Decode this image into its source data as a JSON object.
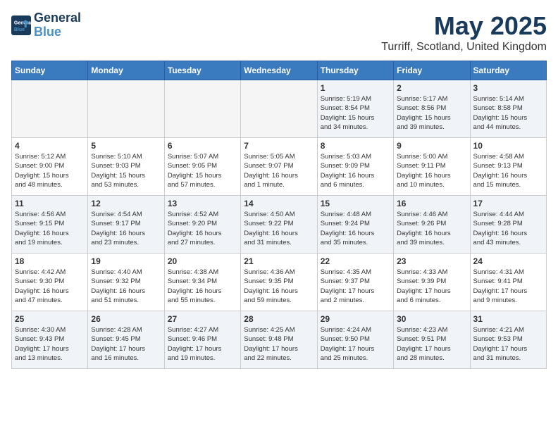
{
  "logo": {
    "line1": "General",
    "line2": "Blue"
  },
  "title": "May 2025",
  "location": "Turriff, Scotland, United Kingdom",
  "days_of_week": [
    "Sunday",
    "Monday",
    "Tuesday",
    "Wednesday",
    "Thursday",
    "Friday",
    "Saturday"
  ],
  "weeks": [
    [
      {
        "day": "",
        "info": "",
        "empty": true
      },
      {
        "day": "",
        "info": "",
        "empty": true
      },
      {
        "day": "",
        "info": "",
        "empty": true
      },
      {
        "day": "",
        "info": "",
        "empty": true
      },
      {
        "day": "1",
        "info": "Sunrise: 5:19 AM\nSunset: 8:54 PM\nDaylight: 15 hours\nand 34 minutes."
      },
      {
        "day": "2",
        "info": "Sunrise: 5:17 AM\nSunset: 8:56 PM\nDaylight: 15 hours\nand 39 minutes."
      },
      {
        "day": "3",
        "info": "Sunrise: 5:14 AM\nSunset: 8:58 PM\nDaylight: 15 hours\nand 44 minutes."
      }
    ],
    [
      {
        "day": "4",
        "info": "Sunrise: 5:12 AM\nSunset: 9:00 PM\nDaylight: 15 hours\nand 48 minutes."
      },
      {
        "day": "5",
        "info": "Sunrise: 5:10 AM\nSunset: 9:03 PM\nDaylight: 15 hours\nand 53 minutes."
      },
      {
        "day": "6",
        "info": "Sunrise: 5:07 AM\nSunset: 9:05 PM\nDaylight: 15 hours\nand 57 minutes."
      },
      {
        "day": "7",
        "info": "Sunrise: 5:05 AM\nSunset: 9:07 PM\nDaylight: 16 hours\nand 1 minute."
      },
      {
        "day": "8",
        "info": "Sunrise: 5:03 AM\nSunset: 9:09 PM\nDaylight: 16 hours\nand 6 minutes."
      },
      {
        "day": "9",
        "info": "Sunrise: 5:00 AM\nSunset: 9:11 PM\nDaylight: 16 hours\nand 10 minutes."
      },
      {
        "day": "10",
        "info": "Sunrise: 4:58 AM\nSunset: 9:13 PM\nDaylight: 16 hours\nand 15 minutes."
      }
    ],
    [
      {
        "day": "11",
        "info": "Sunrise: 4:56 AM\nSunset: 9:15 PM\nDaylight: 16 hours\nand 19 minutes."
      },
      {
        "day": "12",
        "info": "Sunrise: 4:54 AM\nSunset: 9:17 PM\nDaylight: 16 hours\nand 23 minutes."
      },
      {
        "day": "13",
        "info": "Sunrise: 4:52 AM\nSunset: 9:20 PM\nDaylight: 16 hours\nand 27 minutes."
      },
      {
        "day": "14",
        "info": "Sunrise: 4:50 AM\nSunset: 9:22 PM\nDaylight: 16 hours\nand 31 minutes."
      },
      {
        "day": "15",
        "info": "Sunrise: 4:48 AM\nSunset: 9:24 PM\nDaylight: 16 hours\nand 35 minutes."
      },
      {
        "day": "16",
        "info": "Sunrise: 4:46 AM\nSunset: 9:26 PM\nDaylight: 16 hours\nand 39 minutes."
      },
      {
        "day": "17",
        "info": "Sunrise: 4:44 AM\nSunset: 9:28 PM\nDaylight: 16 hours\nand 43 minutes."
      }
    ],
    [
      {
        "day": "18",
        "info": "Sunrise: 4:42 AM\nSunset: 9:30 PM\nDaylight: 16 hours\nand 47 minutes."
      },
      {
        "day": "19",
        "info": "Sunrise: 4:40 AM\nSunset: 9:32 PM\nDaylight: 16 hours\nand 51 minutes."
      },
      {
        "day": "20",
        "info": "Sunrise: 4:38 AM\nSunset: 9:34 PM\nDaylight: 16 hours\nand 55 minutes."
      },
      {
        "day": "21",
        "info": "Sunrise: 4:36 AM\nSunset: 9:35 PM\nDaylight: 16 hours\nand 59 minutes."
      },
      {
        "day": "22",
        "info": "Sunrise: 4:35 AM\nSunset: 9:37 PM\nDaylight: 17 hours\nand 2 minutes."
      },
      {
        "day": "23",
        "info": "Sunrise: 4:33 AM\nSunset: 9:39 PM\nDaylight: 17 hours\nand 6 minutes."
      },
      {
        "day": "24",
        "info": "Sunrise: 4:31 AM\nSunset: 9:41 PM\nDaylight: 17 hours\nand 9 minutes."
      }
    ],
    [
      {
        "day": "25",
        "info": "Sunrise: 4:30 AM\nSunset: 9:43 PM\nDaylight: 17 hours\nand 13 minutes."
      },
      {
        "day": "26",
        "info": "Sunrise: 4:28 AM\nSunset: 9:45 PM\nDaylight: 17 hours\nand 16 minutes."
      },
      {
        "day": "27",
        "info": "Sunrise: 4:27 AM\nSunset: 9:46 PM\nDaylight: 17 hours\nand 19 minutes."
      },
      {
        "day": "28",
        "info": "Sunrise: 4:25 AM\nSunset: 9:48 PM\nDaylight: 17 hours\nand 22 minutes."
      },
      {
        "day": "29",
        "info": "Sunrise: 4:24 AM\nSunset: 9:50 PM\nDaylight: 17 hours\nand 25 minutes."
      },
      {
        "day": "30",
        "info": "Sunrise: 4:23 AM\nSunset: 9:51 PM\nDaylight: 17 hours\nand 28 minutes."
      },
      {
        "day": "31",
        "info": "Sunrise: 4:21 AM\nSunset: 9:53 PM\nDaylight: 17 hours\nand 31 minutes."
      }
    ]
  ]
}
